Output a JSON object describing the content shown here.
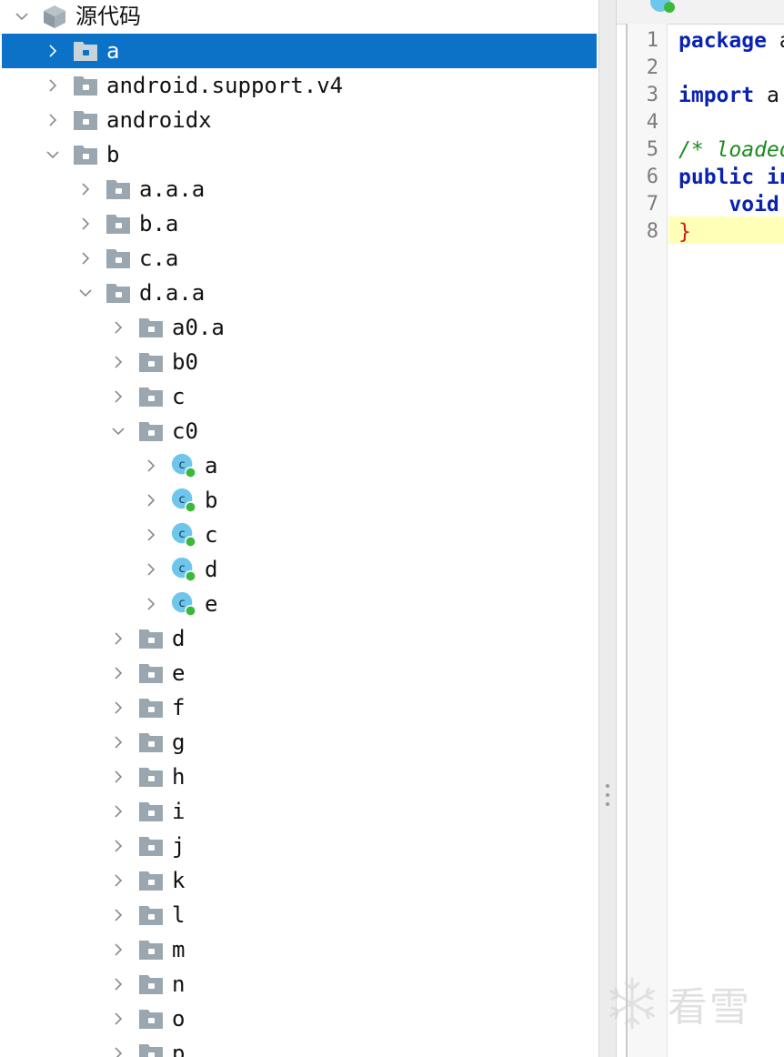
{
  "tree": {
    "root": {
      "label": "源代码",
      "icon": "module-cube-icon",
      "expanded": true
    },
    "nodes": [
      {
        "id": "a",
        "label": "a",
        "expanded": false,
        "icon": "package-folder-icon",
        "selected": true
      },
      {
        "id": "android-support-v4",
        "label": "android.support.v4",
        "expanded": false,
        "icon": "package-folder-icon"
      },
      {
        "id": "androidx",
        "label": "androidx",
        "expanded": false,
        "icon": "package-folder-icon"
      },
      {
        "id": "b",
        "label": "b",
        "expanded": true,
        "icon": "package-folder-icon"
      },
      {
        "id": "a-a-a",
        "label": "a.a.a",
        "expanded": false,
        "icon": "package-folder-icon"
      },
      {
        "id": "b-a",
        "label": "b.a",
        "expanded": false,
        "icon": "package-folder-icon"
      },
      {
        "id": "c-a",
        "label": "c.a",
        "expanded": false,
        "icon": "package-folder-icon"
      },
      {
        "id": "d-a-a",
        "label": "d.a.a",
        "expanded": true,
        "icon": "package-folder-icon"
      },
      {
        "id": "a0-a",
        "label": "a0.a",
        "expanded": false,
        "icon": "package-folder-icon"
      },
      {
        "id": "b0",
        "label": "b0",
        "expanded": false,
        "icon": "package-folder-icon"
      },
      {
        "id": "c",
        "label": "c",
        "expanded": false,
        "icon": "package-folder-icon"
      },
      {
        "id": "c0",
        "label": "c0",
        "expanded": true,
        "icon": "package-folder-icon"
      },
      {
        "id": "c0-a",
        "label": "a",
        "expanded": false,
        "icon": "java-class-icon"
      },
      {
        "id": "c0-b",
        "label": "b",
        "expanded": false,
        "icon": "java-class-icon"
      },
      {
        "id": "c0-c",
        "label": "c",
        "expanded": false,
        "icon": "java-class-icon"
      },
      {
        "id": "c0-d",
        "label": "d",
        "expanded": false,
        "icon": "java-class-icon"
      },
      {
        "id": "c0-e",
        "label": "e",
        "expanded": false,
        "icon": "java-class-icon"
      },
      {
        "id": "d",
        "label": "d",
        "expanded": false,
        "icon": "package-folder-icon"
      },
      {
        "id": "e",
        "label": "e",
        "expanded": false,
        "icon": "package-folder-icon"
      },
      {
        "id": "f",
        "label": "f",
        "expanded": false,
        "icon": "package-folder-icon"
      },
      {
        "id": "g",
        "label": "g",
        "expanded": false,
        "icon": "package-folder-icon"
      },
      {
        "id": "h",
        "label": "h",
        "expanded": false,
        "icon": "package-folder-icon"
      },
      {
        "id": "i",
        "label": "i",
        "expanded": false,
        "icon": "package-folder-icon"
      },
      {
        "id": "j",
        "label": "j",
        "expanded": false,
        "icon": "package-folder-icon"
      },
      {
        "id": "k",
        "label": "k",
        "expanded": false,
        "icon": "package-folder-icon"
      },
      {
        "id": "l",
        "label": "l",
        "expanded": false,
        "icon": "package-folder-icon"
      },
      {
        "id": "m",
        "label": "m",
        "expanded": false,
        "icon": "package-folder-icon"
      },
      {
        "id": "n",
        "label": "n",
        "expanded": false,
        "icon": "package-folder-icon"
      },
      {
        "id": "o",
        "label": "o",
        "expanded": false,
        "icon": "package-folder-icon"
      },
      {
        "id": "p",
        "label": "p",
        "expanded": false,
        "icon": "package-folder-icon"
      }
    ]
  },
  "editor": {
    "tab_icon": "java-class-icon",
    "line_numbers": [
      "1",
      "2",
      "3",
      "4",
      "5",
      "6",
      "7",
      "8"
    ],
    "highlighted_line": "8",
    "lines": {
      "l1_kw": "package",
      "l1_rest": " a",
      "l3_kw": "import",
      "l3_rest": " a",
      "l5_comment": "/* loaded",
      "l6_kw": "public in",
      "l7_kw": "    void",
      "l8_brace": "}"
    }
  },
  "watermark": {
    "text": "看雪",
    "icon": "snowflake-icon"
  },
  "colors": {
    "selection": "#0b72c7",
    "keyword": "#0a22b3",
    "comment": "#1b8a1b",
    "brace": "#d21a1a",
    "current_line": "#ffffb8",
    "folder": "#9aa7b0",
    "class_icon": "#6fc6ec",
    "class_badge": "#3cb83c"
  }
}
